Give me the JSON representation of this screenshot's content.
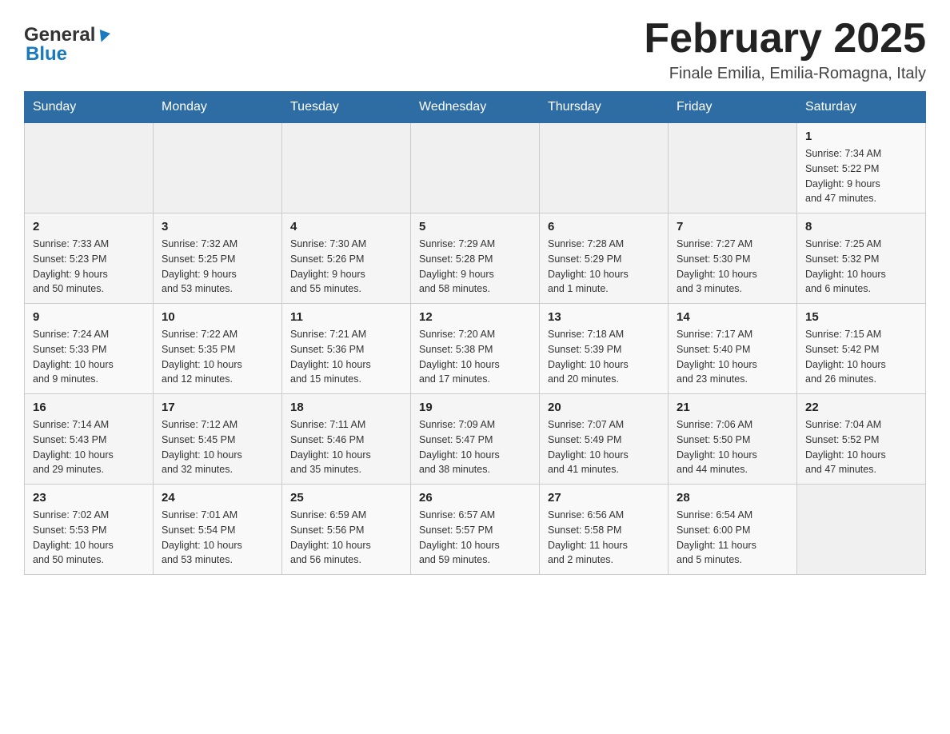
{
  "header": {
    "logo_general": "General",
    "logo_blue": "Blue",
    "title": "February 2025",
    "subtitle": "Finale Emilia, Emilia-Romagna, Italy"
  },
  "weekdays": [
    "Sunday",
    "Monday",
    "Tuesday",
    "Wednesday",
    "Thursday",
    "Friday",
    "Saturday"
  ],
  "weeks": [
    [
      {
        "day": "",
        "info": ""
      },
      {
        "day": "",
        "info": ""
      },
      {
        "day": "",
        "info": ""
      },
      {
        "day": "",
        "info": ""
      },
      {
        "day": "",
        "info": ""
      },
      {
        "day": "",
        "info": ""
      },
      {
        "day": "1",
        "info": "Sunrise: 7:34 AM\nSunset: 5:22 PM\nDaylight: 9 hours\nand 47 minutes."
      }
    ],
    [
      {
        "day": "2",
        "info": "Sunrise: 7:33 AM\nSunset: 5:23 PM\nDaylight: 9 hours\nand 50 minutes."
      },
      {
        "day": "3",
        "info": "Sunrise: 7:32 AM\nSunset: 5:25 PM\nDaylight: 9 hours\nand 53 minutes."
      },
      {
        "day": "4",
        "info": "Sunrise: 7:30 AM\nSunset: 5:26 PM\nDaylight: 9 hours\nand 55 minutes."
      },
      {
        "day": "5",
        "info": "Sunrise: 7:29 AM\nSunset: 5:28 PM\nDaylight: 9 hours\nand 58 minutes."
      },
      {
        "day": "6",
        "info": "Sunrise: 7:28 AM\nSunset: 5:29 PM\nDaylight: 10 hours\nand 1 minute."
      },
      {
        "day": "7",
        "info": "Sunrise: 7:27 AM\nSunset: 5:30 PM\nDaylight: 10 hours\nand 3 minutes."
      },
      {
        "day": "8",
        "info": "Sunrise: 7:25 AM\nSunset: 5:32 PM\nDaylight: 10 hours\nand 6 minutes."
      }
    ],
    [
      {
        "day": "9",
        "info": "Sunrise: 7:24 AM\nSunset: 5:33 PM\nDaylight: 10 hours\nand 9 minutes."
      },
      {
        "day": "10",
        "info": "Sunrise: 7:22 AM\nSunset: 5:35 PM\nDaylight: 10 hours\nand 12 minutes."
      },
      {
        "day": "11",
        "info": "Sunrise: 7:21 AM\nSunset: 5:36 PM\nDaylight: 10 hours\nand 15 minutes."
      },
      {
        "day": "12",
        "info": "Sunrise: 7:20 AM\nSunset: 5:38 PM\nDaylight: 10 hours\nand 17 minutes."
      },
      {
        "day": "13",
        "info": "Sunrise: 7:18 AM\nSunset: 5:39 PM\nDaylight: 10 hours\nand 20 minutes."
      },
      {
        "day": "14",
        "info": "Sunrise: 7:17 AM\nSunset: 5:40 PM\nDaylight: 10 hours\nand 23 minutes."
      },
      {
        "day": "15",
        "info": "Sunrise: 7:15 AM\nSunset: 5:42 PM\nDaylight: 10 hours\nand 26 minutes."
      }
    ],
    [
      {
        "day": "16",
        "info": "Sunrise: 7:14 AM\nSunset: 5:43 PM\nDaylight: 10 hours\nand 29 minutes."
      },
      {
        "day": "17",
        "info": "Sunrise: 7:12 AM\nSunset: 5:45 PM\nDaylight: 10 hours\nand 32 minutes."
      },
      {
        "day": "18",
        "info": "Sunrise: 7:11 AM\nSunset: 5:46 PM\nDaylight: 10 hours\nand 35 minutes."
      },
      {
        "day": "19",
        "info": "Sunrise: 7:09 AM\nSunset: 5:47 PM\nDaylight: 10 hours\nand 38 minutes."
      },
      {
        "day": "20",
        "info": "Sunrise: 7:07 AM\nSunset: 5:49 PM\nDaylight: 10 hours\nand 41 minutes."
      },
      {
        "day": "21",
        "info": "Sunrise: 7:06 AM\nSunset: 5:50 PM\nDaylight: 10 hours\nand 44 minutes."
      },
      {
        "day": "22",
        "info": "Sunrise: 7:04 AM\nSunset: 5:52 PM\nDaylight: 10 hours\nand 47 minutes."
      }
    ],
    [
      {
        "day": "23",
        "info": "Sunrise: 7:02 AM\nSunset: 5:53 PM\nDaylight: 10 hours\nand 50 minutes."
      },
      {
        "day": "24",
        "info": "Sunrise: 7:01 AM\nSunset: 5:54 PM\nDaylight: 10 hours\nand 53 minutes."
      },
      {
        "day": "25",
        "info": "Sunrise: 6:59 AM\nSunset: 5:56 PM\nDaylight: 10 hours\nand 56 minutes."
      },
      {
        "day": "26",
        "info": "Sunrise: 6:57 AM\nSunset: 5:57 PM\nDaylight: 10 hours\nand 59 minutes."
      },
      {
        "day": "27",
        "info": "Sunrise: 6:56 AM\nSunset: 5:58 PM\nDaylight: 11 hours\nand 2 minutes."
      },
      {
        "day": "28",
        "info": "Sunrise: 6:54 AM\nSunset: 6:00 PM\nDaylight: 11 hours\nand 5 minutes."
      },
      {
        "day": "",
        "info": ""
      }
    ]
  ]
}
